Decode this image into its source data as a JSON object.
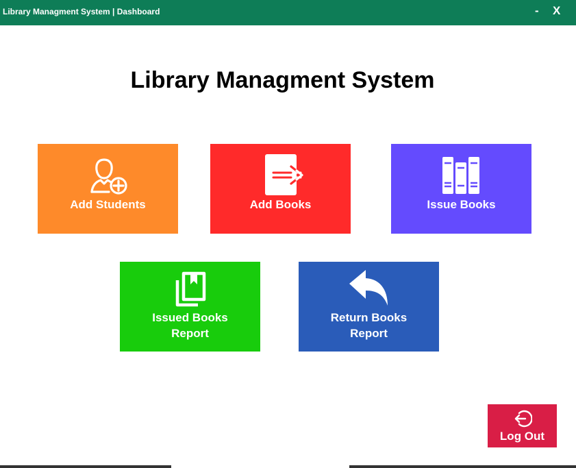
{
  "window": {
    "title": "Library Managment System | Dashboard",
    "minimize": "-",
    "close": "X",
    "bar_color": "#0e7d57"
  },
  "heading": "Library Managment System",
  "tiles": [
    {
      "id": "add-students",
      "label": "Add Students",
      "icon": "add-user-icon",
      "color": "#fe8a2a"
    },
    {
      "id": "add-books",
      "label": "Add Books",
      "icon": "book-arrow-icon",
      "color": "#ff2a2a"
    },
    {
      "id": "issue-books",
      "label": "Issue Books",
      "icon": "bookshelf-icon",
      "color": "#644bfe"
    },
    {
      "id": "issued-books-report",
      "label_line1": "Issued Books",
      "label_line2": "Report",
      "icon": "books-stack-icon",
      "color": "#18cc0c"
    },
    {
      "id": "return-books-report",
      "label_line1": "Return Books",
      "label_line2": "Report",
      "icon": "reply-arrow-icon",
      "color": "#2a5cb9"
    }
  ],
  "logout": {
    "label": "Log Out",
    "icon": "logout-icon",
    "color": "#d91e46"
  }
}
